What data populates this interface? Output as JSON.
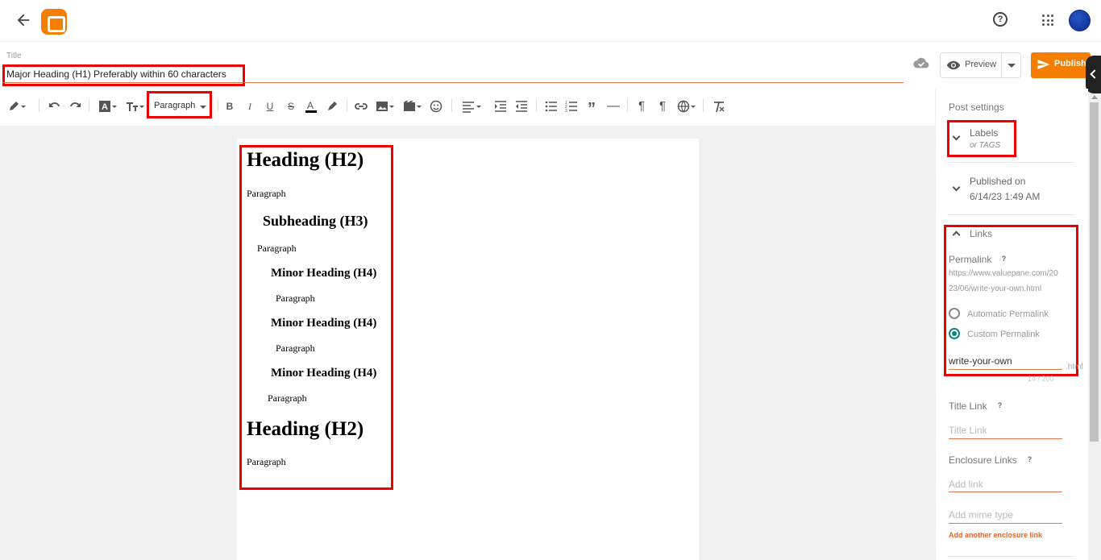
{
  "header": {
    "back_icon": "arrow-left-icon",
    "logo": "blogger-logo",
    "help_icon": "help-circle-icon",
    "apps_icon": "apps-grid-icon",
    "avatar": "user-avatar"
  },
  "title_field": {
    "label": "Title",
    "value": "Major Heading (H1) Preferably within 60 characters"
  },
  "actions": {
    "preview_label": "Preview",
    "publish_label": "Publish",
    "cloud_icon": "cloud-saved-icon"
  },
  "toolbar": {
    "paragraph_style": "Paragraph"
  },
  "editor": {
    "blocks": [
      {
        "type": "h2",
        "text": "Heading (H2)"
      },
      {
        "type": "p",
        "text": "Paragraph"
      },
      {
        "type": "h3",
        "text": "Subheading (H3)"
      },
      {
        "type": "p",
        "text": "Paragraph"
      },
      {
        "type": "h4",
        "text": "Minor Heading (H4)"
      },
      {
        "type": "p",
        "text": "Paragraph"
      },
      {
        "type": "h4",
        "text": "Minor Heading (H4)"
      },
      {
        "type": "p",
        "text": "Paragraph"
      },
      {
        "type": "h4",
        "text": "Minor Heading (H4)"
      },
      {
        "type": "p",
        "text": "Paragraph"
      },
      {
        "type": "h2",
        "text": "Heading (H2)"
      },
      {
        "type": "p",
        "text": "Paragraph"
      }
    ]
  },
  "sidebar": {
    "title": "Post settings",
    "labels": {
      "title": "Labels",
      "hint": "or TAGS"
    },
    "published": {
      "title": "Published on",
      "value": "6/14/23 1:49 AM"
    },
    "links": {
      "title": "Links",
      "permalink_label": "Permalink",
      "permalink_url_line1": "https://www.valuepane.com/20",
      "permalink_url_line2": "23/06/write-your-own.html",
      "auto_label": "Automatic Permalink",
      "custom_label": "Custom Permalink",
      "custom_value": "write-your-own",
      "suffix": ".html",
      "counter": "14 / 200"
    },
    "title_link": {
      "label": "Title Link",
      "placeholder": "Title Link"
    },
    "enclosure": {
      "label": "Enclosure Links",
      "link_placeholder": "Add link",
      "mime_placeholder": "Add mime type",
      "add_another": "Add another enclosure link"
    }
  },
  "colors": {
    "accent": "#f57d00",
    "annotation": "#e00000",
    "radio_selected": "#0a8a7c"
  }
}
